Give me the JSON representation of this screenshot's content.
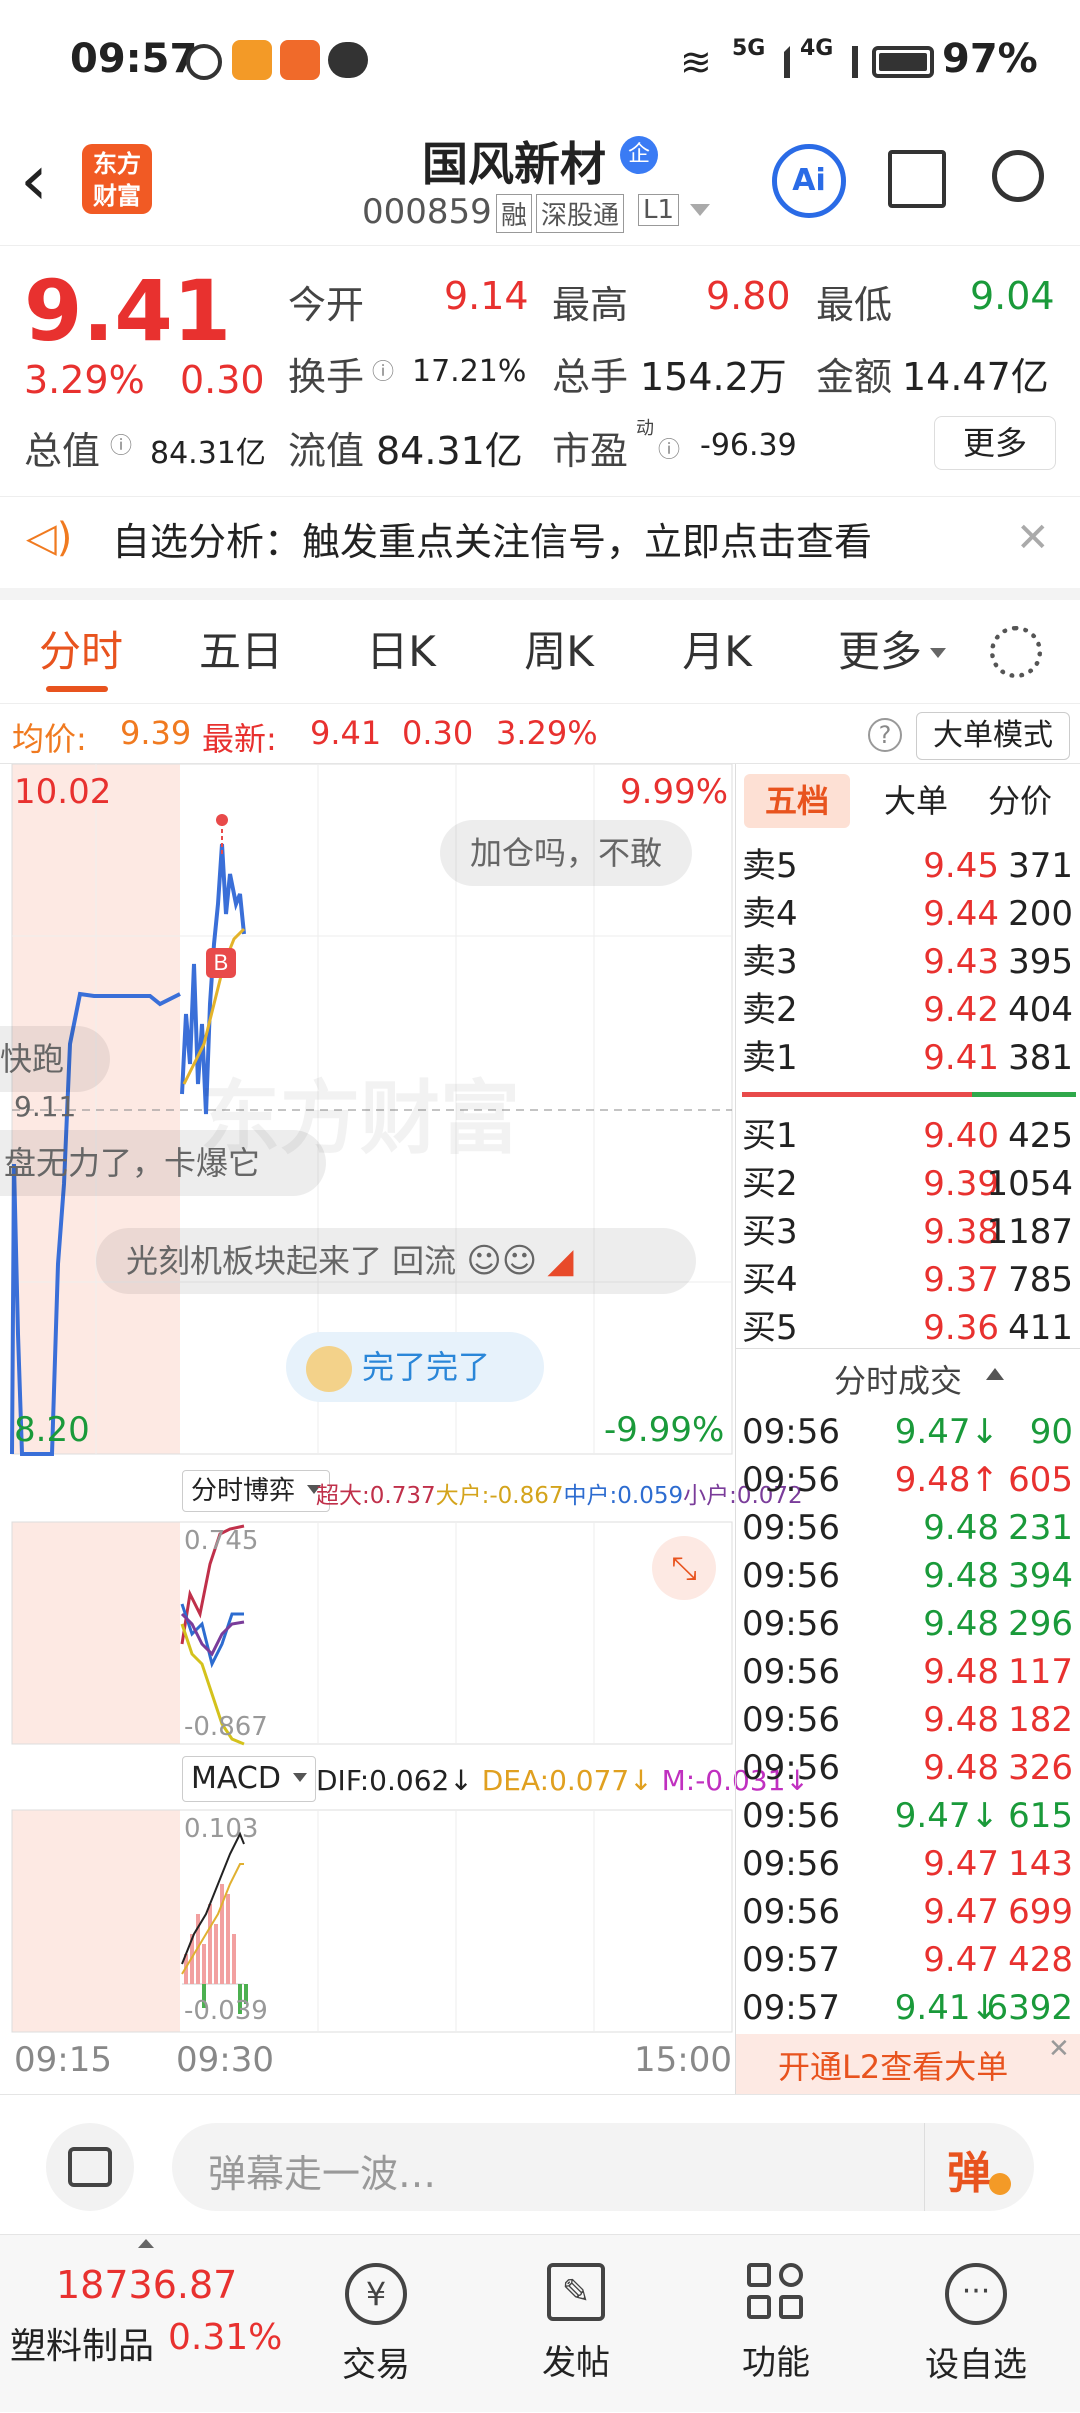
{
  "status": {
    "time": "09:57",
    "battery": "97%",
    "net1": "5G",
    "net2": "4G"
  },
  "header": {
    "logo_line1": "东方",
    "logo_line2": "财富",
    "name": "国风新材",
    "badge": "企",
    "code": "000859",
    "tag_rong": "融",
    "tag_sgt": "深股通",
    "tag_l1": "L1",
    "ai": "Ai"
  },
  "quote": {
    "price": "9.41",
    "pct": "3.29%",
    "chg": "0.30",
    "open_label": "今开",
    "open": "9.14",
    "high_label": "最高",
    "high": "9.80",
    "low_label": "最低",
    "low": "9.04",
    "turnover_label": "换手",
    "turnover": "17.21%",
    "vol_label": "总手",
    "vol": "154.2万",
    "amt_label": "金额",
    "amt": "14.47亿",
    "mcap_label": "总值",
    "mcap": "84.31亿",
    "fmcap_label": "流值",
    "fmcap": "84.31亿",
    "pe_label": "市盈",
    "pe_sup": "动",
    "pe": "-96.39",
    "more": "更多"
  },
  "notice": {
    "text": "自选分析：触发重点关注信号，立即点击查看"
  },
  "tabs": {
    "t1": "分时",
    "t2": "五日",
    "t3": "日K",
    "t4": "周K",
    "t5": "月K",
    "t6": "更多"
  },
  "infobar": {
    "avg_label": "均价:",
    "avg": "9.39",
    "new_label": "最新:",
    "new": "9.41",
    "chg": "0.30",
    "pct": "3.29%",
    "mode": "大单模式"
  },
  "chart": {
    "ymax": "10.02",
    "ymin": "8.20",
    "pmax": "9.99%",
    "pmin": "-9.99%",
    "prev_close": "9.11",
    "watermark": "东方财富",
    "danmu1": "加仓吗，不敢",
    "danmu2": "快跑",
    "danmu3": "盘无力了，卡爆它",
    "danmu4": "光刻机板块起来了 回流",
    "danmu5": "完了完了",
    "flow_title": "分时博弈",
    "flow_super": "超大:0.737",
    "flow_big": "大户:-0.867",
    "flow_mid": "中户:0.059",
    "flow_small": "小户:0.072",
    "flow_max": "0.745",
    "flow_min": "-0.867",
    "macd_title": "MACD",
    "dif": "DIF:0.062",
    "dea": "DEA:0.077",
    "m": "M:-0.031",
    "macd_max": "0.103",
    "macd_min": "-0.039",
    "t_start": "09:15",
    "t_mid": "09:30",
    "t_end": "15:00"
  },
  "orderbook": {
    "tab1": "五档",
    "tab2": "大单",
    "tab3": "分价",
    "asks": [
      {
        "l": "卖5",
        "p": "9.45",
        "v": "371"
      },
      {
        "l": "卖4",
        "p": "9.44",
        "v": "200"
      },
      {
        "l": "卖3",
        "p": "9.43",
        "v": "395"
      },
      {
        "l": "卖2",
        "p": "9.42",
        "v": "404"
      },
      {
        "l": "卖1",
        "p": "9.41",
        "v": "381"
      }
    ],
    "bids": [
      {
        "l": "买1",
        "p": "9.40",
        "v": "425"
      },
      {
        "l": "买2",
        "p": "9.39",
        "v": "1054"
      },
      {
        "l": "买3",
        "p": "9.38",
        "v": "1187"
      },
      {
        "l": "买4",
        "p": "9.37",
        "v": "785"
      },
      {
        "l": "买5",
        "p": "9.36",
        "v": "411"
      }
    ],
    "ticks_title": "分时成交",
    "ticks": [
      {
        "t": "09:56",
        "p": "9.47↓",
        "v": "90",
        "c": "green"
      },
      {
        "t": "09:56",
        "p": "9.48↑",
        "v": "605",
        "c": "red"
      },
      {
        "t": "09:56",
        "p": "9.48",
        "v": "231",
        "c": "green"
      },
      {
        "t": "09:56",
        "p": "9.48",
        "v": "394",
        "c": "green"
      },
      {
        "t": "09:56",
        "p": "9.48",
        "v": "296",
        "c": "green"
      },
      {
        "t": "09:56",
        "p": "9.48",
        "v": "117",
        "c": "red"
      },
      {
        "t": "09:56",
        "p": "9.48",
        "v": "182",
        "c": "red"
      },
      {
        "t": "09:56",
        "p": "9.48",
        "v": "326",
        "c": "red"
      },
      {
        "t": "09:56",
        "p": "9.47↓",
        "v": "615",
        "c": "green"
      },
      {
        "t": "09:56",
        "p": "9.47",
        "v": "143",
        "c": "red"
      },
      {
        "t": "09:56",
        "p": "9.47",
        "v": "699",
        "c": "red"
      },
      {
        "t": "09:57",
        "p": "9.47",
        "v": "428",
        "c": "red"
      },
      {
        "t": "09:57",
        "p": "9.41↓",
        "v": "6392",
        "c": "green"
      }
    ],
    "l2": "开通L2查看大单"
  },
  "input": {
    "placeholder": "弹幕走一波…",
    "danmu_btn": "弹"
  },
  "bottom": {
    "index_val": "18736.87",
    "index_name": "塑料制品",
    "index_pct": "0.31%",
    "n1": "交易",
    "n2": "发帖",
    "n3": "功能",
    "n4": "设自选"
  }
}
